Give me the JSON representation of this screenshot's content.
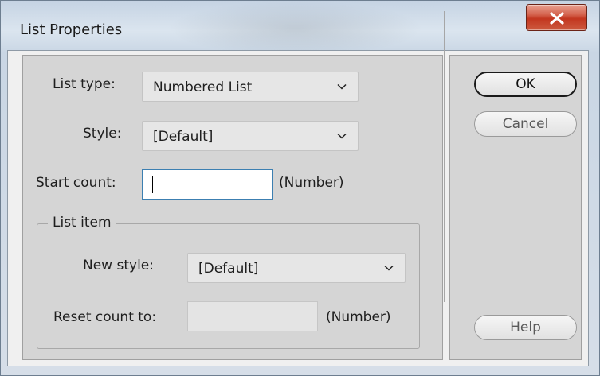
{
  "window": {
    "title": "List Properties"
  },
  "form": {
    "list_type_label": "List type:",
    "list_type_value": "Numbered List",
    "style_label": "Style:",
    "style_value": "[Default]",
    "start_count_label": "Start count:",
    "start_count_value": "",
    "start_count_hint": "(Number)"
  },
  "list_item": {
    "group_title": "List item",
    "new_style_label": "New style:",
    "new_style_value": "[Default]",
    "reset_count_label": "Reset count to:",
    "reset_count_value": "",
    "reset_count_hint": "(Number)"
  },
  "buttons": {
    "ok": "OK",
    "cancel": "Cancel",
    "help": "Help"
  },
  "colors": {
    "close_button": "#c2361f",
    "focus_border": "#3c7fb1",
    "panel": "#d5d5d5"
  },
  "icons": {
    "close": "x-icon",
    "dropdown": "chevron-down-icon"
  }
}
